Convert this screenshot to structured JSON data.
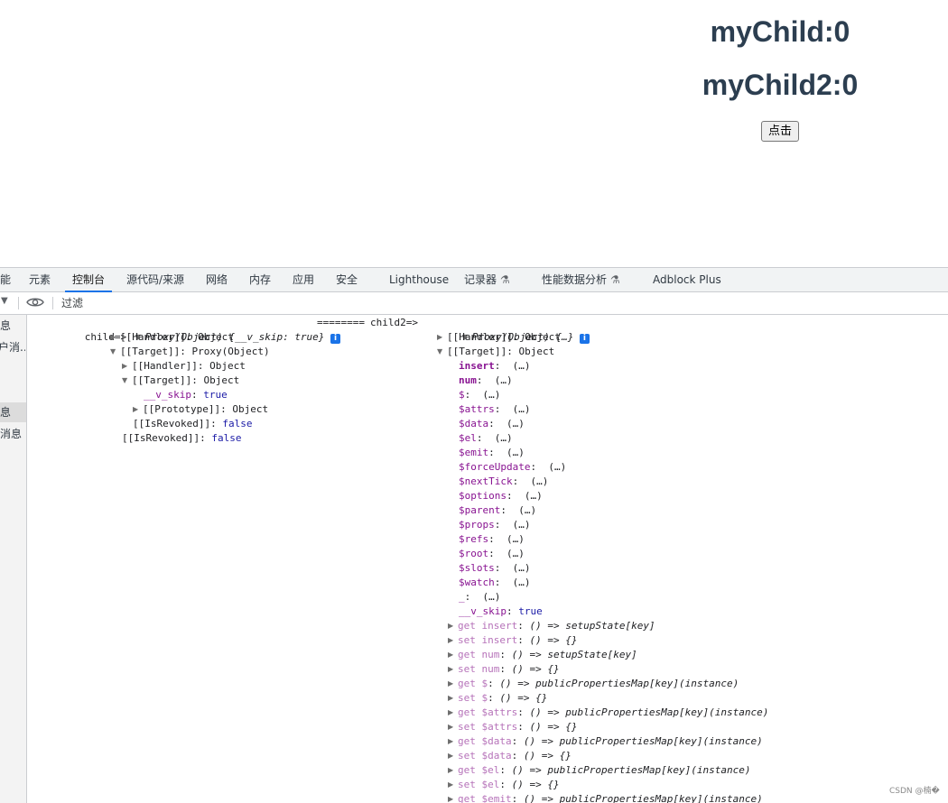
{
  "page": {
    "heading1": "myChild:0",
    "heading2": "myChild2:0",
    "button": "点击"
  },
  "devtools": {
    "tabs": [
      "能",
      "元素",
      "控制台",
      "源代码/来源",
      "网络",
      "内存",
      "应用",
      "安全",
      "Lighthouse",
      "记录器",
      "性能数据分析",
      "Adblock Plus"
    ],
    "active_tab": "控制台",
    "filter_placeholder": "过滤",
    "sidebar": [
      "息",
      "户消...",
      "息",
      "消息"
    ],
    "console": {
      "left": {
        "label": "child=>",
        "summary": "Proxy(Object) {__v_skip: true}",
        "lines": [
          [
            "[[Handler]]",
            "Object"
          ],
          [
            "[[Target]]",
            "Proxy(Object)"
          ],
          [
            "[[Handler]]",
            "Object"
          ],
          [
            "[[Target]]",
            "Object"
          ],
          [
            "__v_skip",
            "true"
          ],
          [
            "[[Prototype]]",
            "Object"
          ],
          [
            "[[IsRevoked]]",
            "false"
          ],
          [
            "[[IsRevoked]]",
            "false"
          ]
        ]
      },
      "separator": "========",
      "right": {
        "label": "child2=>",
        "summary": "Proxy(Object) {…}",
        "handler": [
          "[[Handler]]",
          "Object"
        ],
        "target": [
          "[[Target]]",
          "Object"
        ],
        "keys": [
          "insert",
          "num",
          "$",
          "$attrs",
          "$data",
          "$el",
          "$emit",
          "$forceUpdate",
          "$nextTick",
          "$options",
          "$parent",
          "$props",
          "$refs",
          "$root",
          "$slots",
          "$watch",
          "_"
        ],
        "lazy": "(…)",
        "vskip": [
          "__v_skip",
          "true"
        ],
        "accessors": [
          [
            "get insert",
            "() => setupState[key]"
          ],
          [
            "set insert",
            "() => {}"
          ],
          [
            "get num",
            "() => setupState[key]"
          ],
          [
            "set num",
            "() => {}"
          ],
          [
            "get $",
            "() => publicPropertiesMap[key](instance)"
          ],
          [
            "set $",
            "() => {}"
          ],
          [
            "get $attrs",
            "() => publicPropertiesMap[key](instance)"
          ],
          [
            "set $attrs",
            "() => {}"
          ],
          [
            "get $data",
            "() => publicPropertiesMap[key](instance)"
          ],
          [
            "set $data",
            "() => {}"
          ],
          [
            "get $el",
            "() => publicPropertiesMap[key](instance)"
          ],
          [
            "set $el",
            "() => {}"
          ],
          [
            "get $emit",
            "() => publicPropertiesMap[key](instance)"
          ]
        ]
      }
    }
  },
  "watermark": "CSDN @楠�"
}
